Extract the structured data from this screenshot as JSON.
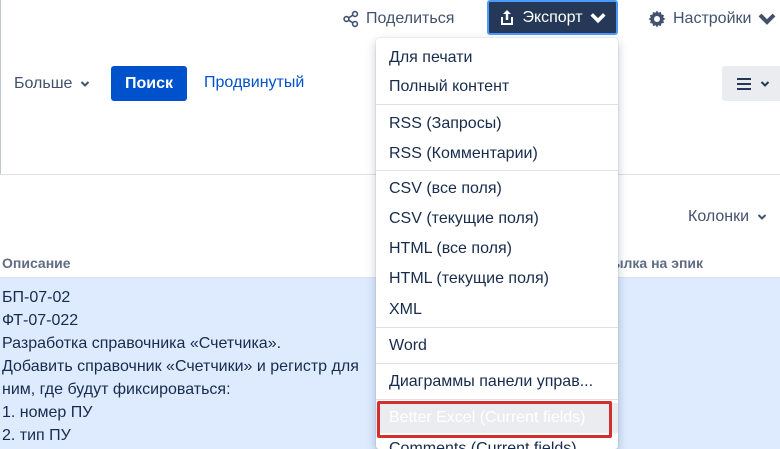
{
  "header": {
    "share_label": "Поделиться",
    "export_label": "Экспорт",
    "settings_label": "Настройки"
  },
  "filter_bar": {
    "more_label": "Больше",
    "search_label": "Поиск",
    "advanced_label": "Продвинутый"
  },
  "table": {
    "columns_label": "Колонки",
    "headers": {
      "description": "Описание",
      "epic_link": "ссылка на эпик"
    },
    "row_description_lines": [
      "БП-07-02",
      "ФТ-07-022",
      "Разработка справочника «Счетчика».",
      "Добавить справочник «Счетчики» и регистр для",
      "ним, где будут фиксироваться:",
      "1. номер ПУ",
      "2. тип ПУ"
    ]
  },
  "export_menu": {
    "items": [
      "Для печати",
      "Полный контент",
      "RSS (Запросы)",
      "RSS (Комментарии)",
      "CSV (все поля)",
      "CSV (текущие поля)",
      "HTML (все поля)",
      "HTML (текущие поля)",
      "XML",
      "Word",
      "Диаграммы панели управ...",
      "Better Excel (Current fields)",
      "Comments (Current fields)"
    ],
    "highlighted_item": "Better Excel (Current fields)"
  },
  "colors": {
    "export_bg": "#253858",
    "primary": "#0052cc",
    "selected_row": "#deebff",
    "annotation_red": "#d32f2f"
  }
}
